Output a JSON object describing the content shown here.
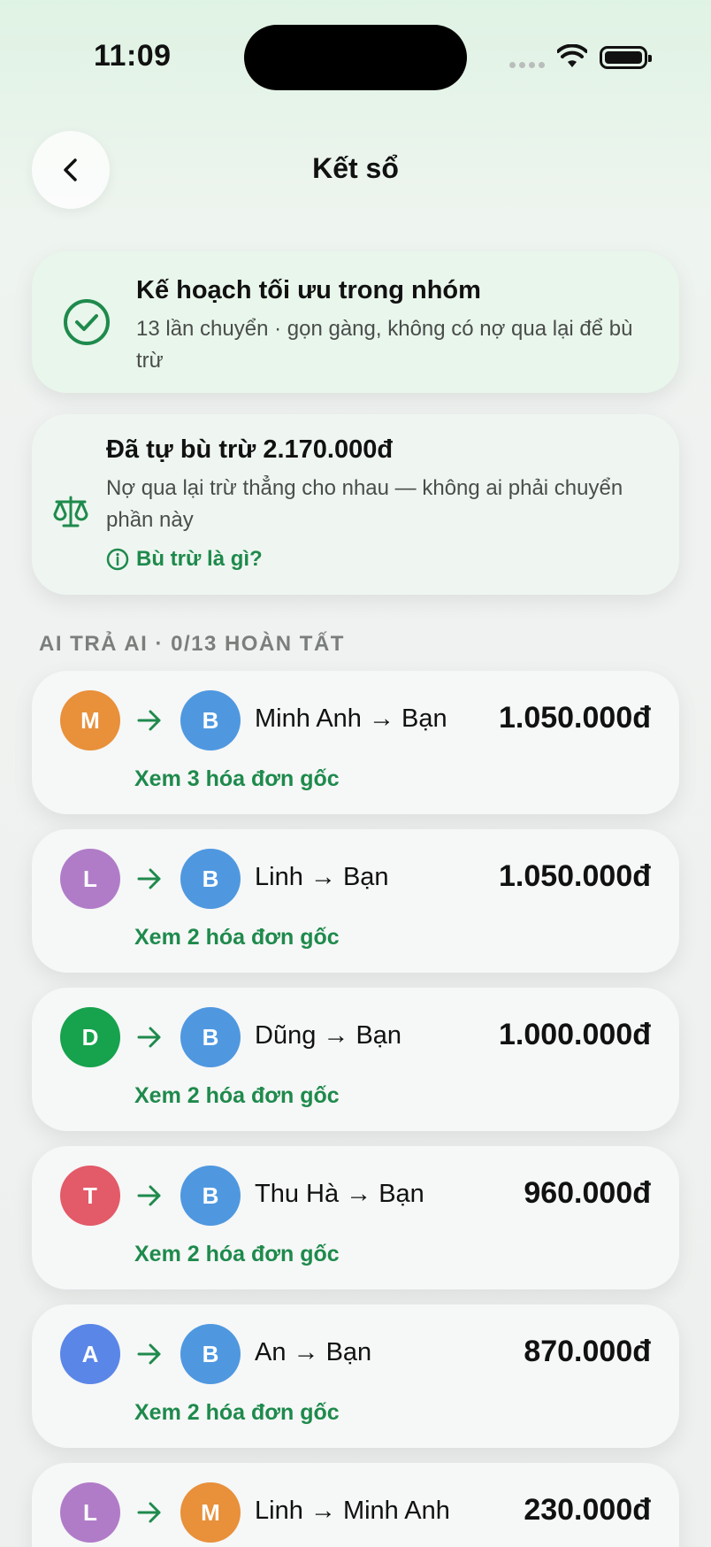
{
  "status_bar": {
    "time": "11:09"
  },
  "header": {
    "title": "Kết sổ",
    "back_icon": "chevron-left-icon"
  },
  "plan_card": {
    "icon": "check-circle-icon",
    "title": "Kế hoạch tối ưu trong nhóm",
    "subtitle": "13 lần chuyển · gọn gàng, không có nợ qua lại để bù trừ"
  },
  "offset_card": {
    "icon": "scale-icon",
    "title": "Đã tự bù trừ 2.170.000đ",
    "subtitle": "Nợ qua lại trừ thẳng cho nhau — không ai phải chuyển phần này",
    "link": "Bù trừ là gì?"
  },
  "section_label": "AI TRẢ AI · 0/13 HOÀN TẤT",
  "colors": {
    "accent": "#1e8a4c",
    "blue": "#4f98e0",
    "orange": "#e8903a",
    "purple": "#b07cc8",
    "green": "#17a24d",
    "red": "#e35a68",
    "indigo": "#5a86e8"
  },
  "transfers": [
    {
      "from_initial": "M",
      "from_color": "#e8903a",
      "to_initial": "B",
      "to_color": "#4f98e0",
      "names": "Minh Anh → Bạn",
      "amount": "1.050.000đ",
      "link": "Xem 3 hóa đơn gốc"
    },
    {
      "from_initial": "L",
      "from_color": "#b07cc8",
      "to_initial": "B",
      "to_color": "#4f98e0",
      "names": "Linh → Bạn",
      "amount": "1.050.000đ",
      "link": "Xem 2 hóa đơn gốc"
    },
    {
      "from_initial": "D",
      "from_color": "#17a24d",
      "to_initial": "B",
      "to_color": "#4f98e0",
      "names": "Dũng → Bạn",
      "amount": "1.000.000đ",
      "link": "Xem 2 hóa đơn gốc"
    },
    {
      "from_initial": "T",
      "from_color": "#e35a68",
      "to_initial": "B",
      "to_color": "#4f98e0",
      "names": "Thu Hà → Bạn",
      "amount": "960.000đ",
      "link": "Xem 2 hóa đơn gốc"
    },
    {
      "from_initial": "A",
      "from_color": "#5a86e8",
      "to_initial": "B",
      "to_color": "#4f98e0",
      "names": "An → Bạn",
      "amount": "870.000đ",
      "link": "Xem 2 hóa đơn gốc"
    },
    {
      "from_initial": "L",
      "from_color": "#b07cc8",
      "to_initial": "M",
      "to_color": "#e8903a",
      "names": "Linh → Minh Anh",
      "amount": "230.000đ",
      "link": ""
    }
  ]
}
